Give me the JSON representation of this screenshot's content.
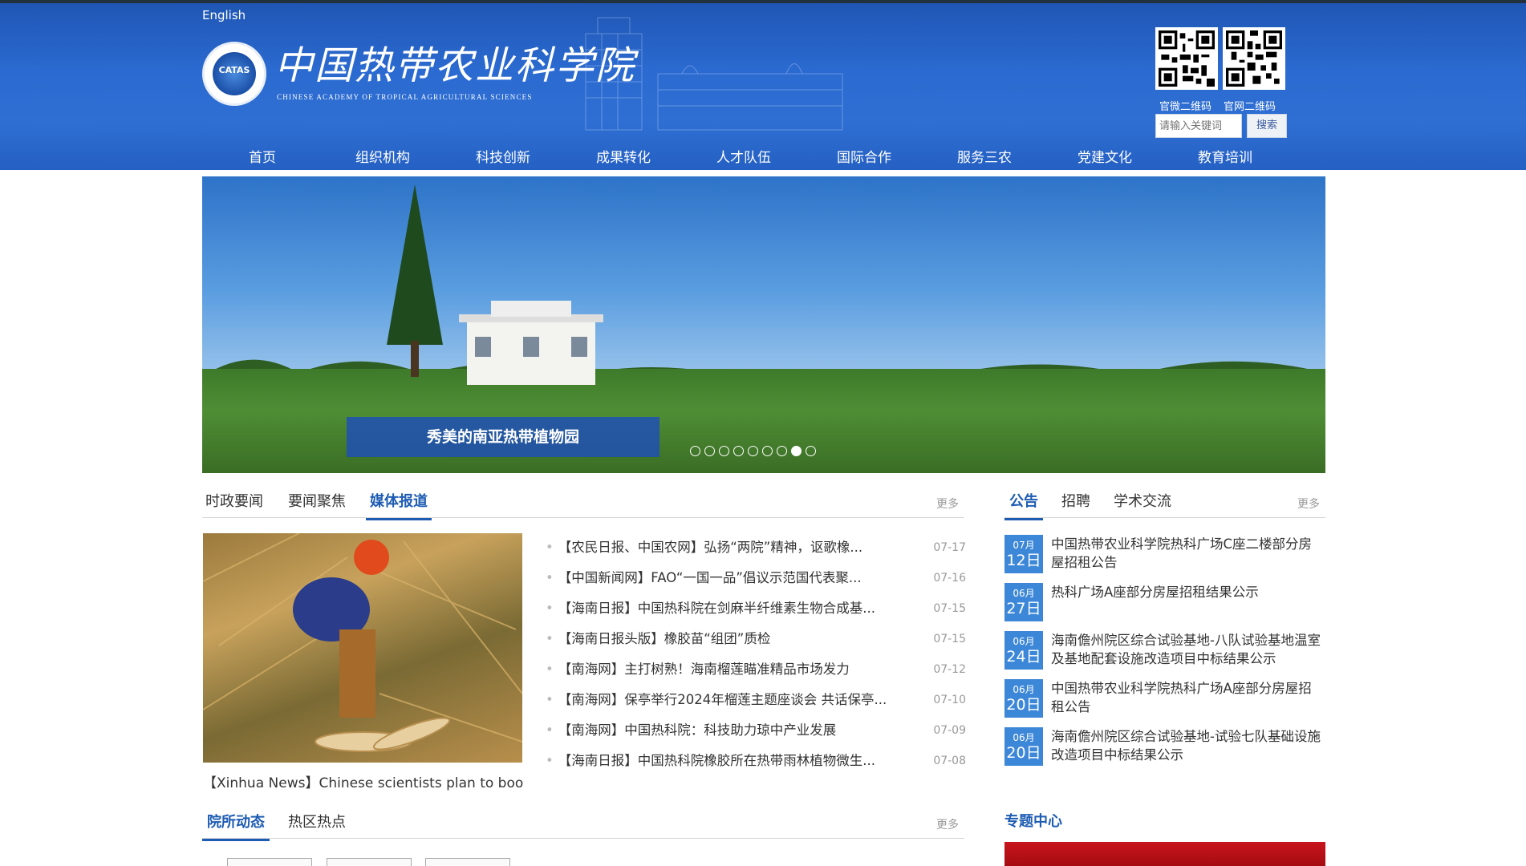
{
  "header": {
    "english_link": "English",
    "logo_text": "CATAS",
    "site_name": "中国热带农业科学院",
    "site_subtitle": "CHINESE ACADEMY OF TROPICAL AGRICULTURAL SCIENCES",
    "qr_wechat_label": "官微二维码",
    "qr_site_label": "官网二维码",
    "search_placeholder": "请输入关键词",
    "search_button": "搜索"
  },
  "nav": [
    "首页",
    "组织机构",
    "科技创新",
    "成果转化",
    "人才队伍",
    "国际合作",
    "服务三农",
    "党建文化",
    "教育培训"
  ],
  "banner": {
    "caption": "秀美的南亚热带植物园",
    "slide_count": 9,
    "active_slide": 8
  },
  "news": {
    "tabs": [
      "时政要闻",
      "要闻聚焦",
      "媒体报道"
    ],
    "active_tab": 2,
    "more": "更多",
    "image_caption": "【Xinhua News】Chinese scientists plan to boo...",
    "items": [
      {
        "title": "【农民日报、中国农网】弘扬“两院”精神，讴歌橡...",
        "date": "07-17"
      },
      {
        "title": "【中国新闻网】FAO“一国一品”倡议示范国代表聚...",
        "date": "07-16"
      },
      {
        "title": "【海南日报】中国热科院在剑麻半纤维素生物合成基...",
        "date": "07-15"
      },
      {
        "title": "【海南日报头版】橡胶苗“组团”质检",
        "date": "07-15"
      },
      {
        "title": "【南海网】主打树熟！海南榴莲瞄准精品市场发力",
        "date": "07-12"
      },
      {
        "title": "【南海网】保亭举行2024年榴莲主题座谈会 共话保亭...",
        "date": "07-10"
      },
      {
        "title": "【南海网】中国热科院：科技助力琼中产业发展",
        "date": "07-09"
      },
      {
        "title": "【海南日报】中国热科院橡胶所在热带雨林植物微生...",
        "date": "07-08"
      }
    ]
  },
  "notices": {
    "tabs": [
      "公告",
      "招聘",
      "学术交流"
    ],
    "active_tab": 0,
    "more": "更多",
    "items": [
      {
        "month": "07月",
        "day": "12日",
        "title": "中国热带农业科学院热科广场C座二楼部分房屋招租公告"
      },
      {
        "month": "06月",
        "day": "27日",
        "title": "热科广场A座部分房屋招租结果公示"
      },
      {
        "month": "06月",
        "day": "24日",
        "title": "海南儋州院区综合试验基地-八队试验基地温室及基地配套设施改造项目中标结果公示"
      },
      {
        "month": "06月",
        "day": "20日",
        "title": "中国热带农业科学院热科广场A座部分房屋招租公告"
      },
      {
        "month": "06月",
        "day": "20日",
        "title": "海南儋州院区综合试验基地-试验七队基础设施改造项目中标结果公示"
      }
    ]
  },
  "institute": {
    "tabs": [
      "院所动态",
      "热区热点"
    ],
    "active_tab": 0,
    "more": "更多"
  },
  "topics": {
    "title": "专题中心"
  }
}
